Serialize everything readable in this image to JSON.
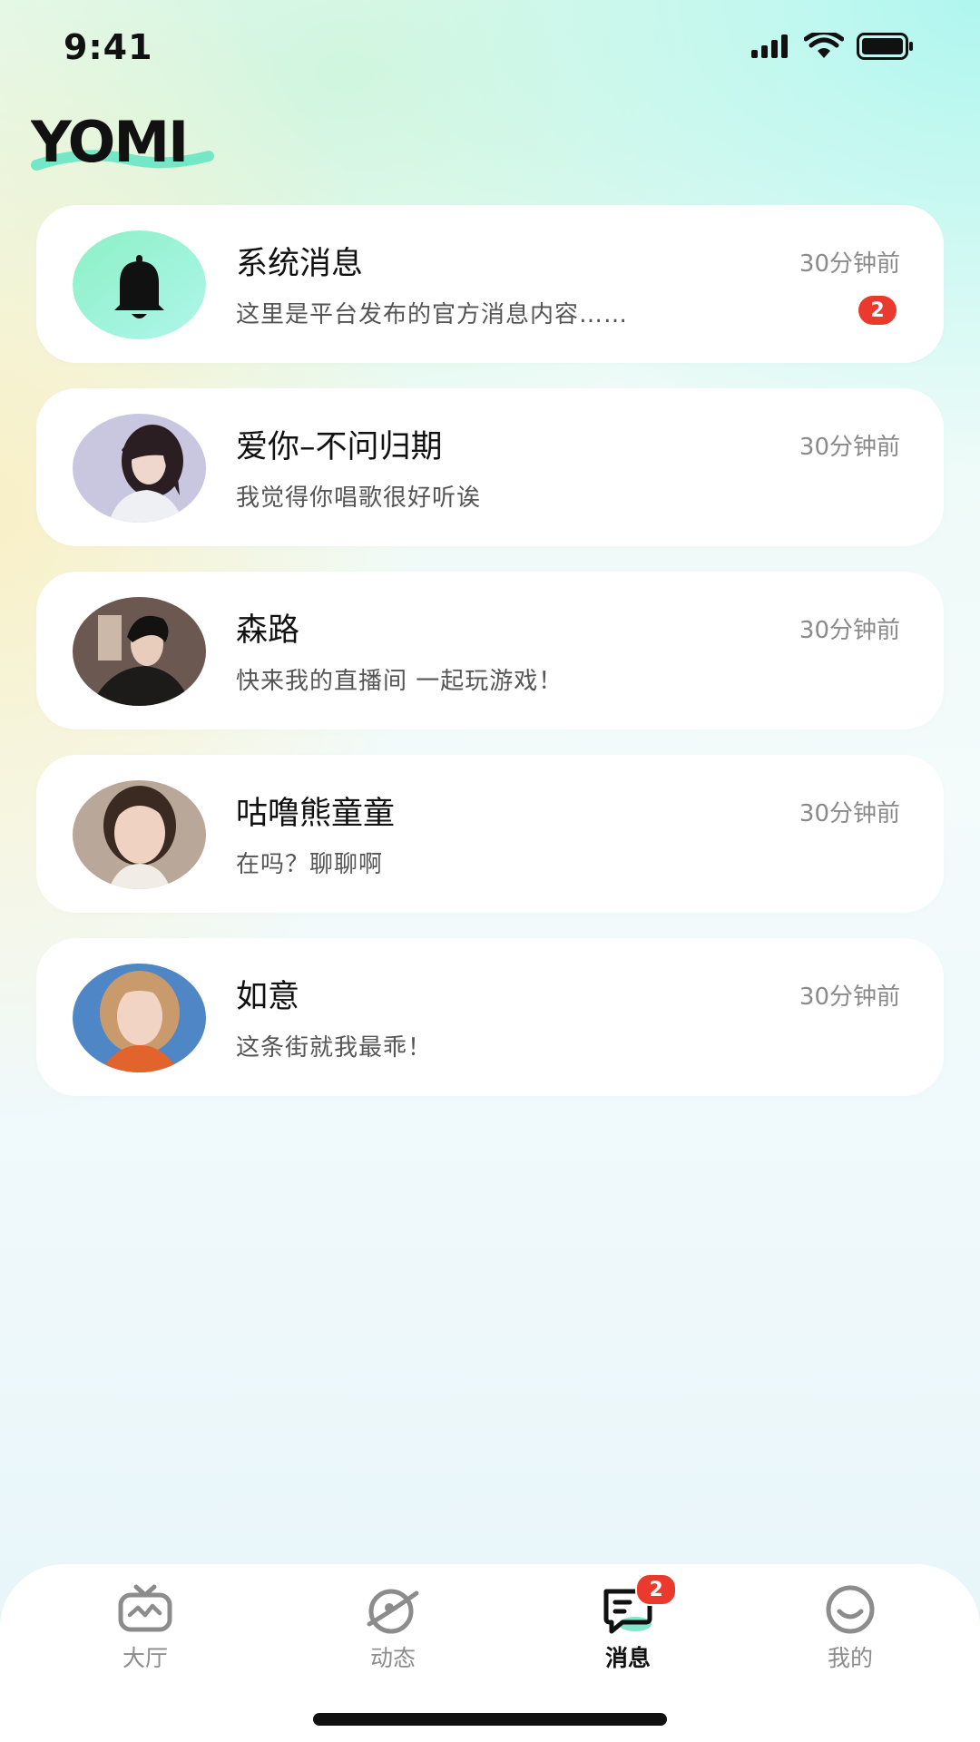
{
  "status_bar": {
    "time": "9:41"
  },
  "logo": {
    "text": "YOMI"
  },
  "messages": [
    {
      "name": "系统消息",
      "time": "30分钟前",
      "preview": "这里是平台发布的官方消息内容……",
      "unread": "2",
      "avatar": "bell-icon"
    },
    {
      "name": "爱你–不问归期",
      "time": "30分钟前",
      "preview": "我觉得你唱歌很好听诶"
    },
    {
      "name": "森路",
      "time": "30分钟前",
      "preview": "快来我的直播间 一起玩游戏！"
    },
    {
      "name": "咕噜熊童童",
      "time": "30分钟前",
      "preview": "在吗？聊聊啊"
    },
    {
      "name": "如意",
      "time": "30分钟前",
      "preview": "这条街就我最乖！"
    }
  ],
  "nav": {
    "items": [
      {
        "label": "大厅",
        "icon": "tv-icon"
      },
      {
        "label": "动态",
        "icon": "planet-icon"
      },
      {
        "label": "消息",
        "icon": "chat-icon",
        "badge": "2",
        "active": true
      },
      {
        "label": "我的",
        "icon": "smile-icon"
      }
    ]
  },
  "colors": {
    "accent": "#78e8c8",
    "badge": "#ea3a2e"
  }
}
